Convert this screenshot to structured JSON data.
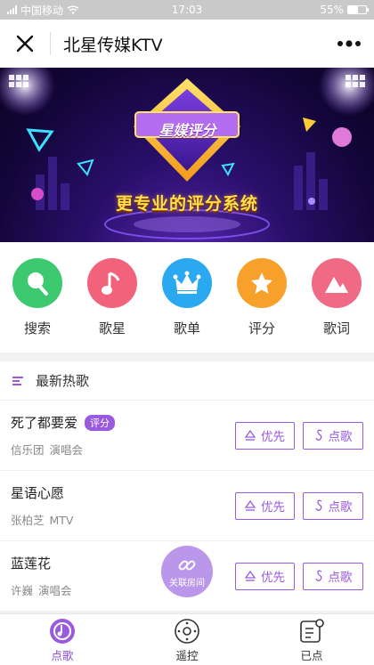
{
  "status_bar": {
    "carrier": "中国移动",
    "time": "17:03",
    "battery": "55%"
  },
  "nav": {
    "title": "北星传媒KTV"
  },
  "banner": {
    "badge_text": "星媒评分",
    "slogan": "更专业的评分系统"
  },
  "categories": [
    {
      "label": "搜索",
      "color": "#3cc96f",
      "icon": "search-icon"
    },
    {
      "label": "歌星",
      "color": "#f2627a",
      "icon": "music-note-icon"
    },
    {
      "label": "歌单",
      "color": "#2aa8f0",
      "icon": "crown-icon"
    },
    {
      "label": "评分",
      "color": "#f7a12a",
      "icon": "star-icon"
    },
    {
      "label": "歌词",
      "color": "#f06a86",
      "icon": "mountain-icon"
    }
  ],
  "section": {
    "title": "最新热歌"
  },
  "songs": [
    {
      "name": "死了都要爱",
      "tag": "评分",
      "artist": "信乐团",
      "type": "演唱会"
    },
    {
      "name": "星语心愿",
      "tag": "",
      "artist": "张柏芝",
      "type": "MTV"
    },
    {
      "name": "蓝莲花",
      "tag": "",
      "artist": "许巍",
      "type": "演唱会"
    }
  ],
  "buttons": {
    "priority": "优先",
    "request": "点歌"
  },
  "float_button": {
    "label": "关联房间"
  },
  "tabs": [
    {
      "label": "点歌",
      "icon": "music-disc-icon",
      "active": true
    },
    {
      "label": "遥控",
      "icon": "remote-control-icon",
      "active": false
    },
    {
      "label": "已点",
      "icon": "playlist-icon",
      "active": false
    }
  ],
  "colors": {
    "accent": "#9a5ae0"
  }
}
